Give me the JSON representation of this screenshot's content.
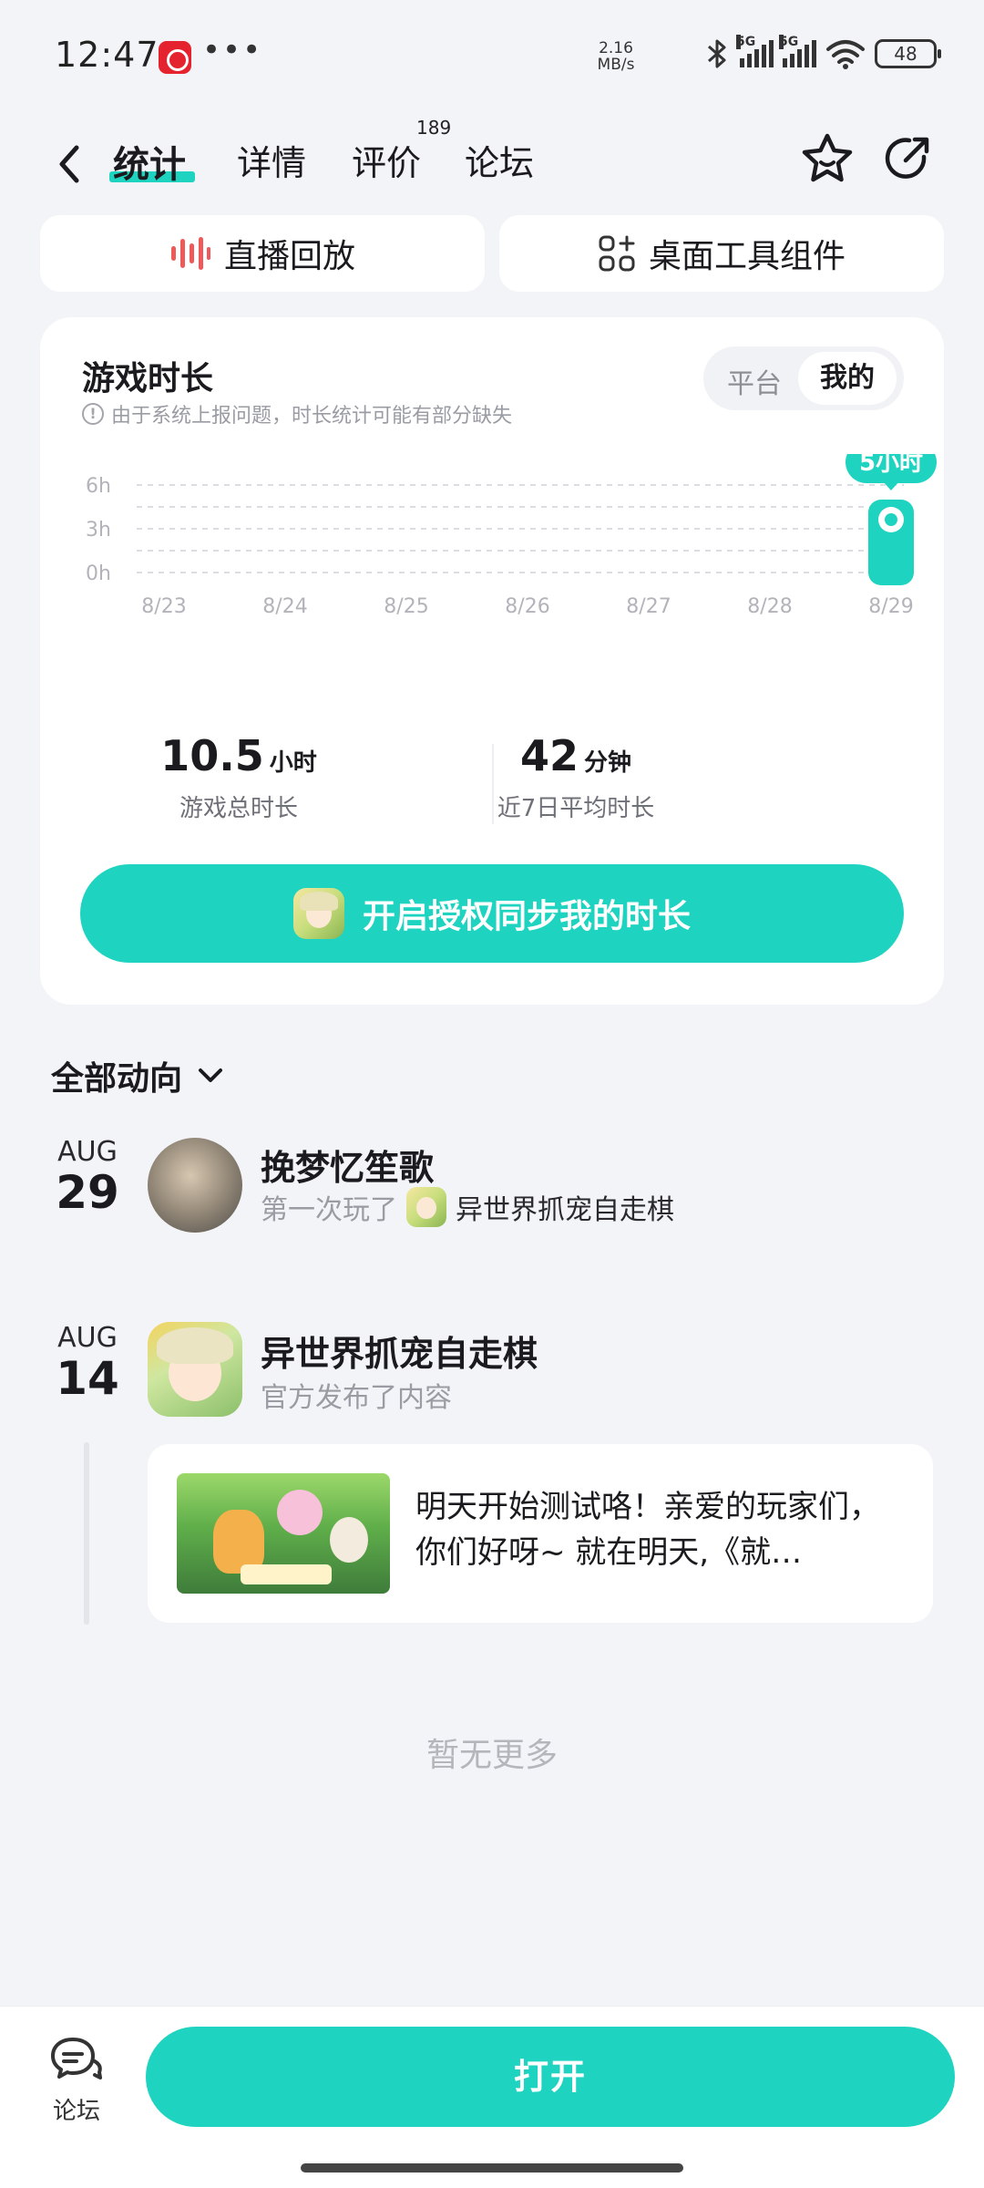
{
  "status_bar": {
    "time": "12:47",
    "more": "•••",
    "net_speed_value": "2.16",
    "net_speed_unit": "MB/s",
    "signal_1": "5G",
    "signal_2": "5G",
    "battery": "48"
  },
  "nav": {
    "tabs": [
      {
        "label": "统计",
        "active": true
      },
      {
        "label": "详情"
      },
      {
        "label": "评价"
      },
      {
        "label": "论坛"
      }
    ],
    "review_count": "189"
  },
  "actions": [
    {
      "label": "直播回放",
      "icon": "live-bars-icon"
    },
    {
      "label": "桌面工具组件",
      "icon": "widget-grid-icon"
    }
  ],
  "stats": {
    "title": "游戏时长",
    "note": "由于系统上报问题，时长统计可能有部分缺失",
    "segment": {
      "off": "平台",
      "on": "我的"
    },
    "total": {
      "value": "10.5",
      "unit": "小时",
      "label": "游戏总时长"
    },
    "average": {
      "value": "42",
      "unit": "分钟",
      "label": "近7日平均时长"
    },
    "auth_button": "开启授权同步我的时长"
  },
  "chart_data": {
    "type": "bar",
    "categories": [
      "8/23",
      "8/24",
      "8/25",
      "8/26",
      "8/27",
      "8/28",
      "8/29"
    ],
    "values": [
      0,
      0,
      0,
      0,
      0,
      0,
      5
    ],
    "y_ticks": [
      "0h",
      "3h",
      "6h"
    ],
    "ylim": [
      0,
      6
    ],
    "tooltip": "5小时",
    "tooltip_index": 6,
    "grid": true,
    "bar_color": "#1ed4c0"
  },
  "feed": {
    "header": "全部动向",
    "items": [
      {
        "month": "AUG",
        "day": "29",
        "name": "挽梦忆笙歌",
        "sub_prefix": "第一次玩了",
        "sub_game": "异世界抓宠自走棋"
      },
      {
        "month": "AUG",
        "day": "14",
        "name": "异世界抓宠自走棋",
        "sub_prefix": "官方发布了内容",
        "post_text": "明天开始测试咯！亲爱的玩家们，你们好呀~  就在明天,《就…"
      }
    ],
    "no_more": "暂无更多"
  },
  "bottom": {
    "forum_label": "论坛",
    "open_button": "打开"
  },
  "colors": {
    "accent": "#1ed4c0",
    "live_icon": "#ee5a5a",
    "background": "#f3f4f8"
  }
}
